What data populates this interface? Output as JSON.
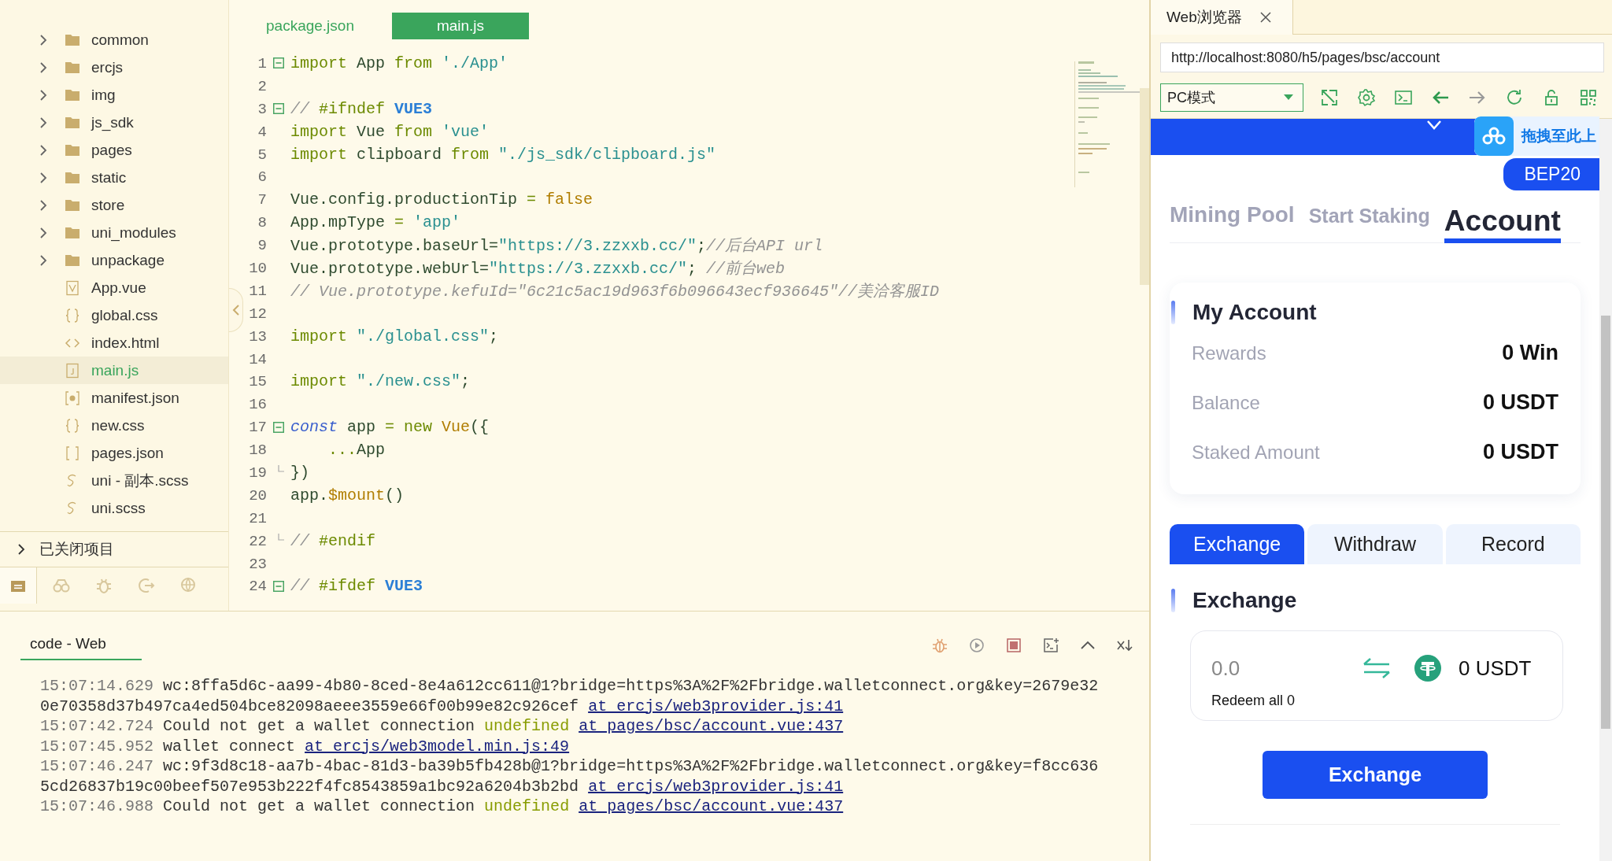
{
  "sidebar": {
    "items": [
      {
        "label": "common",
        "kind": "folder",
        "expanded": false,
        "selected": false
      },
      {
        "label": "ercjs",
        "kind": "folder",
        "expanded": false,
        "selected": false
      },
      {
        "label": "img",
        "kind": "folder",
        "expanded": false,
        "selected": false
      },
      {
        "label": "js_sdk",
        "kind": "folder",
        "expanded": false,
        "selected": false
      },
      {
        "label": "pages",
        "kind": "folder",
        "expanded": false,
        "selected": false
      },
      {
        "label": "static",
        "kind": "folder",
        "expanded": false,
        "selected": false
      },
      {
        "label": "store",
        "kind": "folder",
        "expanded": false,
        "selected": false
      },
      {
        "label": "uni_modules",
        "kind": "folder",
        "expanded": false,
        "selected": false
      },
      {
        "label": "unpackage",
        "kind": "folder",
        "expanded": false,
        "selected": false
      },
      {
        "label": "App.vue",
        "kind": "vue",
        "selected": false
      },
      {
        "label": "global.css",
        "kind": "css",
        "selected": false
      },
      {
        "label": "index.html",
        "kind": "html",
        "selected": false
      },
      {
        "label": "main.js",
        "kind": "js",
        "selected": true
      },
      {
        "label": "manifest.json",
        "kind": "manifest",
        "selected": false
      },
      {
        "label": "new.css",
        "kind": "css",
        "selected": false
      },
      {
        "label": "pages.json",
        "kind": "json",
        "selected": false
      },
      {
        "label": "uni - 副本.scss",
        "kind": "scss",
        "selected": false
      },
      {
        "label": "uni.scss",
        "kind": "scss",
        "selected": false
      }
    ],
    "closed_projects": {
      "label": "已关闭项目",
      "expanded": false
    },
    "tool_tabs": [
      {
        "selected": true
      },
      {
        "selected": false
      },
      {
        "selected": false
      },
      {
        "selected": false
      },
      {
        "selected": false
      }
    ]
  },
  "editor": {
    "tabs": [
      {
        "label": "package.json",
        "selected": false
      },
      {
        "label": "main.js",
        "selected": true
      }
    ],
    "lines": [
      {
        "number": "1",
        "collapsed": false,
        "tokens": [
          {
            "kind": "kw",
            "text": "import"
          },
          {
            "kind": "plain",
            "text": " App "
          },
          {
            "kind": "kw",
            "text": "from"
          },
          {
            "kind": "str",
            "text": " './App'"
          }
        ]
      },
      {
        "number": "2"
      },
      {
        "number": "3",
        "collapsed": false,
        "tokens": [
          {
            "kind": "cmt",
            "text": "// "
          },
          {
            "kind": "pre",
            "text": "#ifndef"
          },
          {
            "kind": "mac",
            "text": " VUE3"
          }
        ]
      },
      {
        "number": "4",
        "tokens": [
          {
            "kind": "kw",
            "text": "import"
          },
          {
            "kind": "plain",
            "text": " Vue "
          },
          {
            "kind": "kw",
            "text": "from"
          },
          {
            "kind": "str",
            "text": " 'vue'"
          }
        ]
      },
      {
        "number": "5",
        "tokens": [
          {
            "kind": "kw",
            "text": "import"
          },
          {
            "kind": "plain",
            "text": " clipboard "
          },
          {
            "kind": "kw",
            "text": "from"
          },
          {
            "kind": "str",
            "text": " \"./js_sdk/clipboard.js\""
          }
        ]
      },
      {
        "number": "6"
      },
      {
        "number": "7",
        "tokens": [
          {
            "kind": "plain",
            "text": "Vue.config.productionTip "
          },
          {
            "kind": "op",
            "text": "="
          },
          {
            "kind": "typ",
            "text": " false"
          }
        ]
      },
      {
        "number": "8",
        "tokens": [
          {
            "kind": "plain",
            "text": "App.mpType "
          },
          {
            "kind": "op",
            "text": "="
          },
          {
            "kind": "str",
            "text": " 'app'"
          }
        ]
      },
      {
        "number": "9",
        "tokens": [
          {
            "kind": "plain",
            "text": "Vue.prototype.baseUrl="
          },
          {
            "kind": "str",
            "text": "\"https://3.zzxxb.cc/\""
          },
          {
            "kind": "plain",
            "text": ";"
          },
          {
            "kind": "cmt",
            "text": "//后台API url"
          }
        ]
      },
      {
        "number": "10",
        "tokens": [
          {
            "kind": "plain",
            "text": "Vue.prototype.webUrl="
          },
          {
            "kind": "str",
            "text": "\"https://3.zzxxb.cc/\""
          },
          {
            "kind": "plain",
            "text": "; "
          },
          {
            "kind": "cmt",
            "text": "//前台web"
          }
        ]
      },
      {
        "number": "11",
        "tokens": [
          {
            "kind": "cmt",
            "text": "// Vue.prototype.kefuId=\"6c21c5ac19d963f6b096643ecf936645\"//美洽客服ID"
          }
        ]
      },
      {
        "number": "12"
      },
      {
        "number": "13",
        "tokens": [
          {
            "kind": "kw",
            "text": "import"
          },
          {
            "kind": "str",
            "text": " \"./global.css\""
          },
          {
            "kind": "plain",
            "text": ";"
          }
        ]
      },
      {
        "number": "14"
      },
      {
        "number": "15",
        "tokens": [
          {
            "kind": "kw",
            "text": "import"
          },
          {
            "kind": "str",
            "text": " \"./new.css\""
          },
          {
            "kind": "plain",
            "text": ";"
          }
        ]
      },
      {
        "number": "16"
      },
      {
        "number": "17",
        "collapsed": false,
        "tokens": [
          {
            "kind": "dec",
            "text": "const"
          },
          {
            "kind": "plain",
            "text": " app "
          },
          {
            "kind": "op",
            "text": "="
          },
          {
            "kind": "kw",
            "text": " new"
          },
          {
            "kind": "typ",
            "text": " Vue"
          },
          {
            "kind": "plain",
            "text": "({"
          }
        ]
      },
      {
        "number": "18",
        "tokens": [
          {
            "kind": "op",
            "text": "    ..."
          },
          {
            "kind": "plain",
            "text": "App"
          }
        ]
      },
      {
        "number": "19",
        "block_end": true,
        "tokens": [
          {
            "kind": "plain",
            "text": "})"
          }
        ]
      },
      {
        "number": "20",
        "tokens": [
          {
            "kind": "plain",
            "text": "app."
          },
          {
            "kind": "typ",
            "text": "$mount"
          },
          {
            "kind": "plain",
            "text": "()"
          }
        ]
      },
      {
        "number": "21"
      },
      {
        "number": "22",
        "block_end": true,
        "tokens": [
          {
            "kind": "cmt",
            "text": "// "
          },
          {
            "kind": "pre",
            "text": "#endif"
          }
        ]
      },
      {
        "number": "23"
      },
      {
        "number": "24",
        "collapsed": false,
        "tokens": [
          {
            "kind": "cmt",
            "text": "// "
          },
          {
            "kind": "pre",
            "text": "#ifdef"
          },
          {
            "kind": "mac",
            "text": " VUE3"
          }
        ]
      }
    ]
  },
  "console": {
    "tab": "code - Web",
    "entries": [
      {
        "time": "15:07:14.629",
        "parts": [
          {
            "kind": "text",
            "text": "wc:8ffa5d6c-aa99-4b80-8ced-8e4a612cc611@1?bridge=https%3A%2F%2Fbridge.walletconnect.org&key=2679e320e70358d37b497ca4ed504bce82098aeee3559e66f00b99e82c926cef"
          },
          {
            "kind": "link",
            "text": "at ercjs/web3provider.js:41"
          }
        ]
      },
      {
        "time": "15:07:42.724",
        "parts": [
          {
            "kind": "text",
            "text": "Could not get a wallet connection"
          },
          {
            "kind": "warn",
            "text": "undefined"
          },
          {
            "kind": "link",
            "text": "at pages/bsc/account.vue:437"
          }
        ]
      },
      {
        "time": "15:07:45.952",
        "parts": [
          {
            "kind": "text",
            "text": "wallet connect"
          },
          {
            "kind": "link",
            "text": "at ercjs/web3model.min.js:49"
          }
        ]
      },
      {
        "time": "15:07:46.247",
        "parts": [
          {
            "kind": "text",
            "text": "wc:9f3d8c18-aa7b-4bac-81d3-ba39b5fb428b@1?bridge=https%3A%2F%2Fbridge.walletconnect.org&key=f8cc6365cd26837b19c00beef507e953b222f4fc8543859a1bc92a6204b3b2bd"
          },
          {
            "kind": "link",
            "text": "at ercjs/web3provider.js:41"
          }
        ]
      },
      {
        "time": "15:07:46.988",
        "parts": [
          {
            "kind": "text",
            "text": "Could not get a wallet connection"
          },
          {
            "kind": "warn",
            "text": "undefined"
          },
          {
            "kind": "link",
            "text": "at pages/bsc/account.vue:437"
          }
        ]
      }
    ]
  },
  "browser": {
    "tab": "Web浏览器",
    "url": "http://localhost:8080/h5/pages/bsc/account",
    "mode": "PC模式",
    "upload_hint": "拖拽至此上",
    "page": {
      "network": "BEP20",
      "tabs": [
        {
          "label": "Mining Pool",
          "selected": false
        },
        {
          "label": "Start Staking",
          "selected": false
        },
        {
          "label": "Account",
          "selected": true
        }
      ],
      "account": {
        "title": "My Account",
        "rows": [
          {
            "label": "Rewards",
            "value": "0 Win"
          },
          {
            "label": "Balance",
            "value": "0 USDT"
          },
          {
            "label": "Staked Amount",
            "value": "0 USDT"
          }
        ]
      },
      "action_tabs": [
        {
          "label": "Exchange",
          "selected": true
        },
        {
          "label": "Withdraw",
          "selected": false
        },
        {
          "label": "Record",
          "selected": false
        }
      ],
      "exchange": {
        "title": "Exchange",
        "placeholder": "0.0",
        "redeem": "Redeem all 0",
        "balance": "0 USDT",
        "button": "Exchange"
      }
    }
  }
}
